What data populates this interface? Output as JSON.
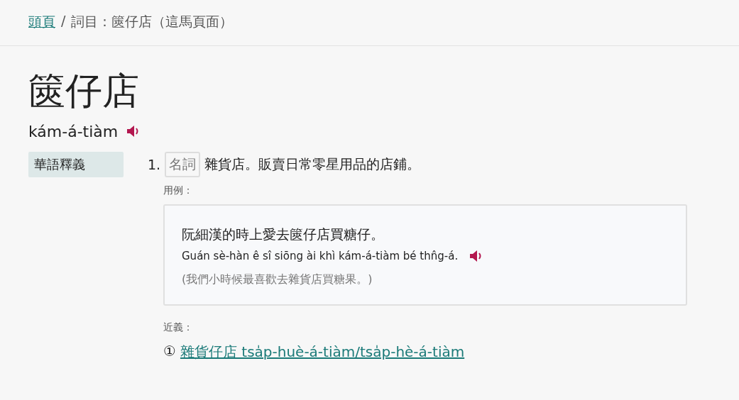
{
  "breadcrumb": {
    "home": "頭頁",
    "separator": "/",
    "current": "詞目：篋仔店（這馬頁面）"
  },
  "entry": {
    "title": "篋仔店",
    "romanization": "kám-á-tiàm"
  },
  "sections": [
    {
      "label": "華語釋義",
      "definitions": [
        {
          "number": "1.",
          "part_of_speech": "名詞",
          "text": "雜貨店。販賣日常零星用品的店鋪。",
          "examples_label": "用例：",
          "examples": [
            {
              "hanji": "阮細漢的時上愛去篋仔店買糖仔。",
              "romanization": "Guán sè-hàn ê sî siōng ài khì kám-á-tiàm bé thn̂g-á.",
              "translation": "(我們小時候最喜歡去雜貨店買糖果。)"
            }
          ],
          "synonyms_label": "近義：",
          "synonyms": [
            {
              "marker": "①",
              "text": "雜貨仔店 tsa̍p-huè-á-tiàm/tsa̍p-hè-á-tiàm"
            }
          ]
        }
      ]
    }
  ]
}
